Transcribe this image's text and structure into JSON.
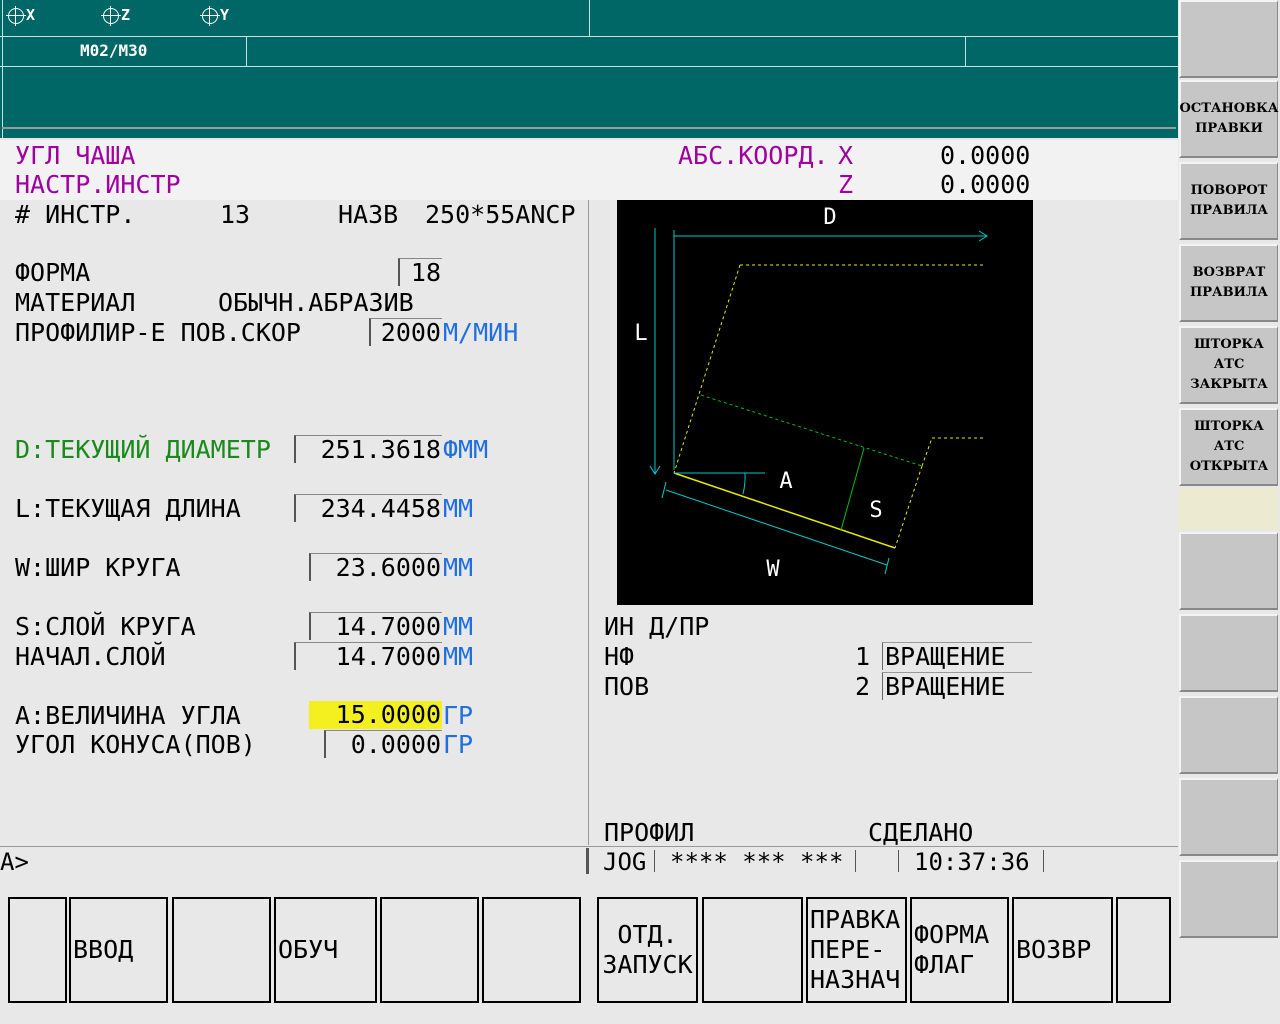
{
  "header": {
    "axes": [
      "X",
      "Z",
      "Y"
    ],
    "mcode": "M02/M30"
  },
  "info": {
    "mode": "УГЛ ЧАША",
    "setup": "НАСТР.ИНСТР",
    "coord_label": "АБС.КООРД.",
    "x_axis": "X",
    "x_value": "0.0000",
    "z_axis": "Z",
    "z_value": "0.0000"
  },
  "tool": {
    "number_label": "# ИНСТР.",
    "number": "13",
    "name_label": "НАЗВ",
    "name": "250*55ANCP",
    "form_label": "ФОРМА",
    "form_value": "18",
    "material_label": "МАТЕРИАЛ",
    "material_value": "ОБЫЧН.АБРАЗИВ",
    "speed_label": "ПРОФИЛИР-Е ПОВ.СКОР",
    "speed_value": "2000",
    "speed_unit": "М/МИН"
  },
  "params": {
    "d_label": "D:ТЕКУЩИЙ ДИАМЕТР",
    "d_value": "251.3618",
    "d_unit": "ФММ",
    "l_label": "L:ТЕКУЩАЯ ДЛИНА",
    "l_value": "234.4458",
    "l_unit": "ММ",
    "w_label": "W:ШИР КРУГА",
    "w_value": "23.6000",
    "w_unit": "ММ",
    "s_label": "S:СЛОЙ КРУГА",
    "s_value": "14.7000",
    "s_unit": "ММ",
    "init_label": "НАЧАЛ.СЛОЙ",
    "init_value": "14.7000",
    "init_unit": "ММ",
    "a_label": "A:ВЕЛИЧИНА УГЛА",
    "a_value": "15.0000",
    "a_unit": "ГР",
    "cone_label": "УГОЛ КОНУСА(ПОВ)",
    "cone_value": "0.0000",
    "cone_unit": "ГР"
  },
  "diagram": {
    "labels": {
      "d": "D",
      "l": "L",
      "a": "A",
      "s": "S",
      "w": "W"
    },
    "colors": {
      "dim": "#00c8c8",
      "profile": "#e8e800",
      "layer": "#00c000"
    }
  },
  "dress": {
    "title": "ИН Д/ПР",
    "nf_label": "НФ",
    "nf_num": "1",
    "nf_value": "ВРАЩЕНИЕ",
    "pov_label": "ПОВ",
    "pov_num": "2",
    "pov_value": "ВРАЩЕНИЕ",
    "profile_label": "ПРОФИЛ",
    "done_label": "СДЕЛАНО"
  },
  "status": {
    "prompt": "A>",
    "mode": "JOG",
    "indicators": "**** *** ***",
    "time": "10:37:36"
  },
  "softkeys_bottom": [
    "",
    "ВВОД",
    "",
    "ОБУЧ",
    "",
    "",
    "ОТД.\nЗАПУСК",
    "",
    "ПРАВКА\nПЕРЕ-\nНАЗНАЧ",
    "ФОРМА\nФЛАГ",
    "ВОЗВР",
    ""
  ],
  "softkeys_side": [
    "",
    "ОСТАНОВКА\nПРАВКИ",
    "ПОВОРОТ\nПРАВИЛА",
    "ВОЗВРАТ\nПРАВИЛА",
    "ШТОРКА\nАТС\nЗАКРЫТА",
    "ШТОРКА\nАТС\nОТКРЫТА",
    "",
    "",
    "",
    "",
    ""
  ],
  "colors": {
    "header_bg": "#006666",
    "mode_text": "#a000a0",
    "unit_text": "#1f6fe0",
    "highlight": "#f4f020",
    "d_label": "#1a8a1a"
  }
}
